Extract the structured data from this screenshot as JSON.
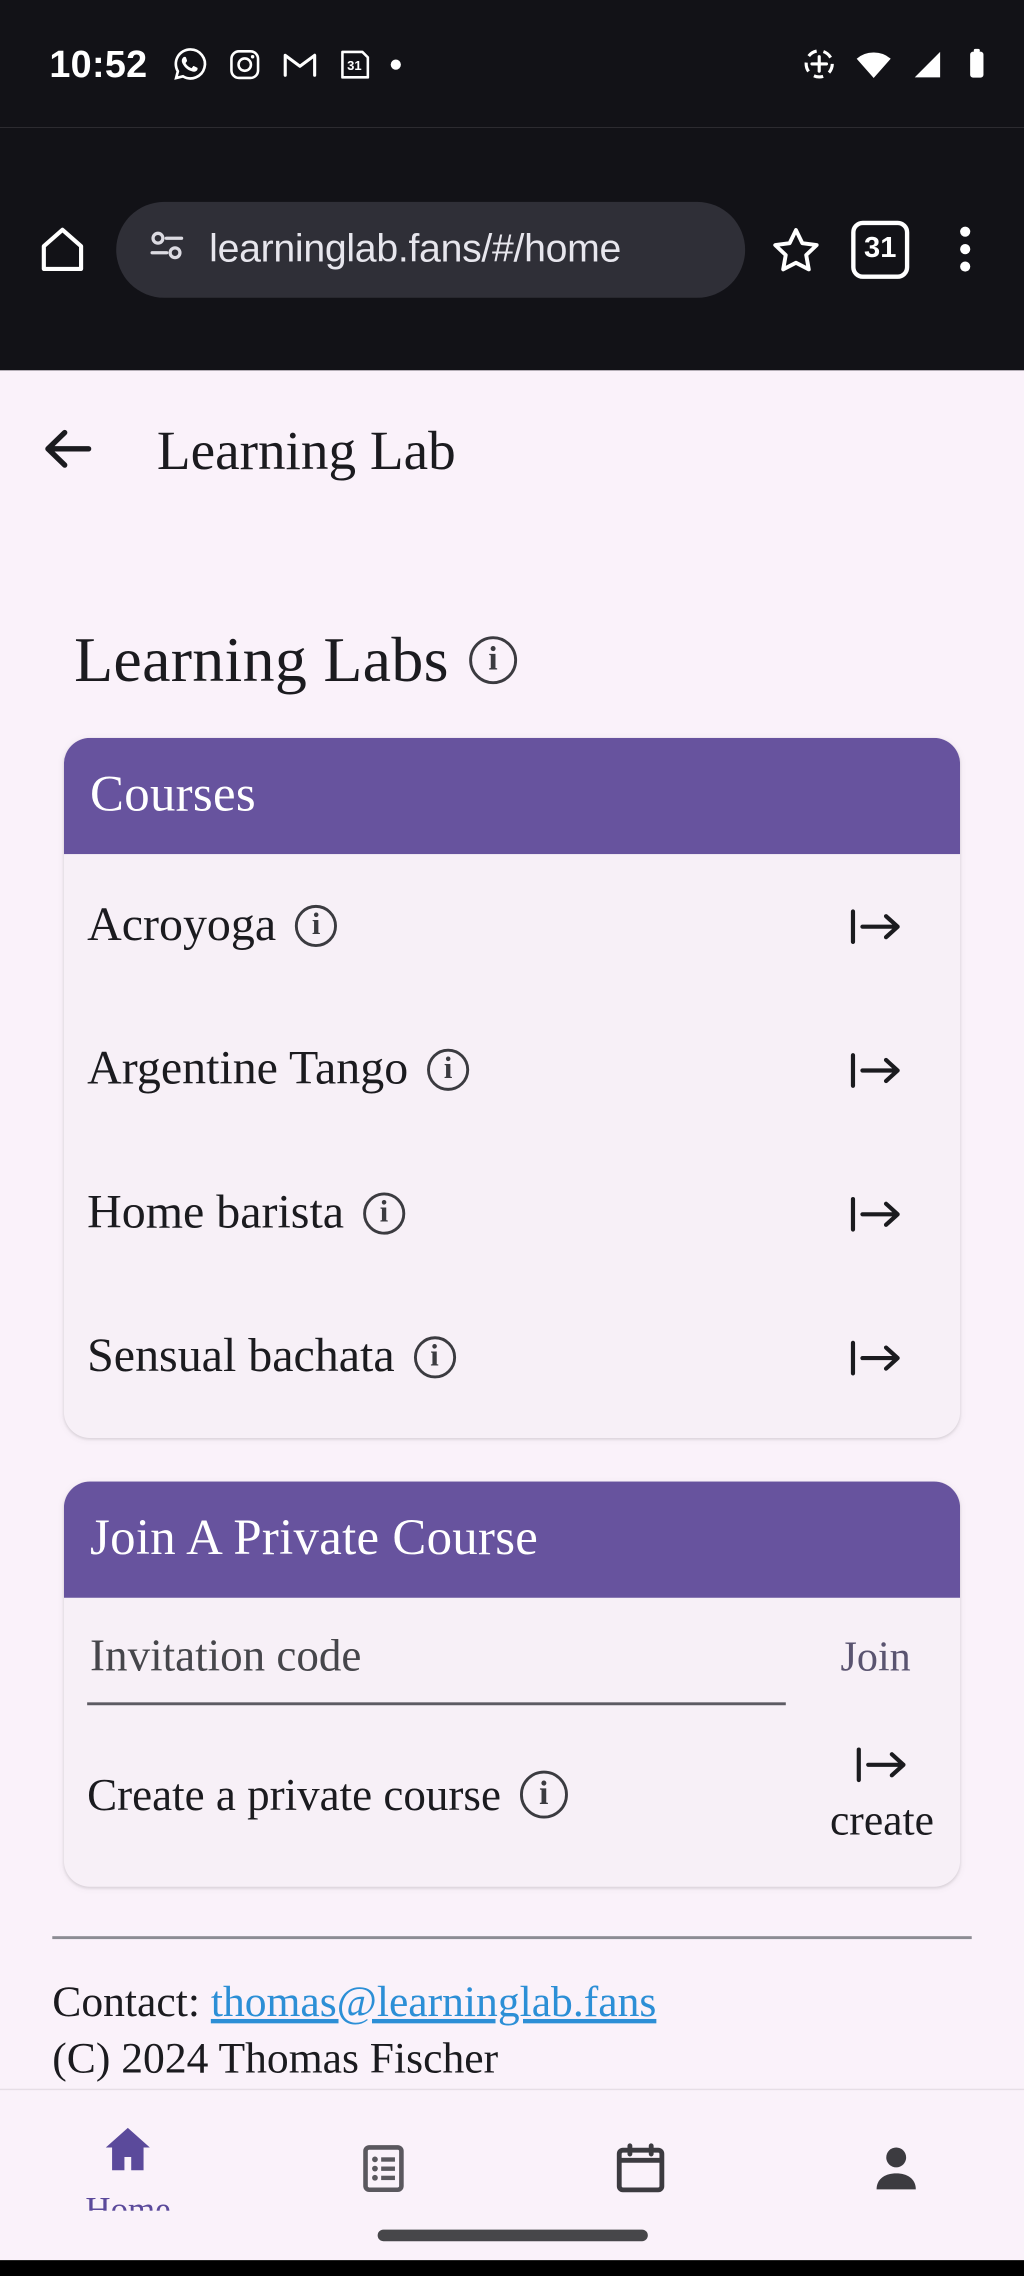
{
  "status_bar": {
    "time": "10:52",
    "notification_icons": [
      "whatsapp-icon",
      "instagram-icon",
      "gmail-icon",
      "calendar-31-icon",
      "dot-icon"
    ],
    "system_icons": [
      "location-icon",
      "wifi-icon",
      "cellular-signal-icon",
      "battery-icon"
    ]
  },
  "browser": {
    "url": "learninglab.fans/#/home",
    "tab_count": "31",
    "icons": [
      "home-icon",
      "site-permissions-icon",
      "bookmark-star-icon",
      "tab-switcher-icon",
      "overflow-menu-icon"
    ]
  },
  "app_bar": {
    "back_label": "back",
    "title": "Learning Lab"
  },
  "page": {
    "title": "Learning Labs",
    "title_info_tooltip": "info"
  },
  "courses_card": {
    "header": "Courses",
    "items": [
      {
        "label": "Acroyoga",
        "action": "enter"
      },
      {
        "label": "Argentine Tango",
        "action": "enter"
      },
      {
        "label": "Home barista",
        "action": "enter"
      },
      {
        "label": "Sensual bachata",
        "action": "enter"
      }
    ]
  },
  "join_card": {
    "header": "Join A Private Course",
    "invitation_code_placeholder": "Invitation code",
    "invitation_code_value": "",
    "join_label": "Join",
    "create_label": "Create a private course",
    "create_action_label": "create"
  },
  "footer": {
    "contact_prefix": "Contact: ",
    "contact_email": "thomas@learninglab.fans",
    "copyright": "(C) 2024 Thomas Fischer"
  },
  "bottom_nav": {
    "items": [
      {
        "label": "Home",
        "icon": "home-icon",
        "active": true
      },
      {
        "label": "",
        "icon": "list-icon",
        "active": false
      },
      {
        "label": "",
        "icon": "calendar-icon",
        "active": false
      },
      {
        "label": "",
        "icon": "person-icon",
        "active": false
      }
    ]
  },
  "colors": {
    "accent_purple": "#67539e",
    "nav_active": "#5b4a9b",
    "page_background": "#faf2fa",
    "link_blue": "#2c8fd6"
  }
}
